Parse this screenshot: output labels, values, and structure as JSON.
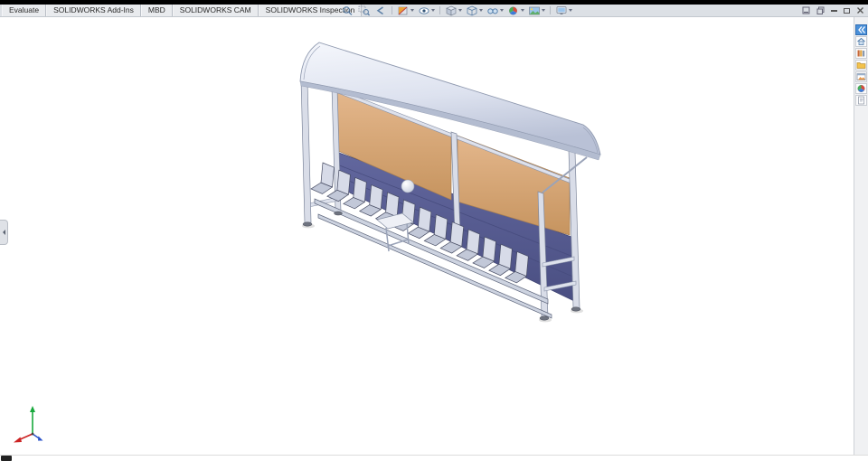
{
  "ribbon": {
    "tabs": [
      {
        "label": "Evaluate"
      },
      {
        "label": "SOLIDWORKS Add-Ins"
      },
      {
        "label": "MBD"
      },
      {
        "label": "SOLIDWORKS CAM"
      },
      {
        "label": "SOLIDWORKS Inspection"
      }
    ]
  },
  "hud_toolbar": {
    "tools": [
      {
        "name": "zoom-to-fit"
      },
      {
        "name": "zoom-to-area"
      },
      {
        "name": "previous-view"
      },
      {
        "name": "section-view",
        "dropdown": true
      },
      {
        "name": "dynamic-annotation-views",
        "dropdown": true
      },
      {
        "name": "view-orientation",
        "dropdown": true
      },
      {
        "name": "display-style",
        "dropdown": true
      },
      {
        "name": "hide-show-items",
        "dropdown": true
      },
      {
        "name": "edit-appearance",
        "dropdown": true
      },
      {
        "name": "apply-scene",
        "dropdown": true
      },
      {
        "name": "view-settings",
        "dropdown": true
      }
    ]
  },
  "window_controls": {
    "items": [
      {
        "name": "doc-minimize"
      },
      {
        "name": "doc-restore"
      },
      {
        "name": "minimize"
      },
      {
        "name": "maximize"
      },
      {
        "name": "close"
      }
    ]
  },
  "task_pane": {
    "items": [
      {
        "name": "expand-task-pane",
        "active": true
      },
      {
        "name": "solidworks-resources",
        "active": false
      },
      {
        "name": "design-library",
        "active": false
      },
      {
        "name": "file-explorer",
        "active": false
      },
      {
        "name": "view-palette",
        "active": false
      },
      {
        "name": "appearances-scenes",
        "active": false
      },
      {
        "name": "custom-properties",
        "active": false
      }
    ]
  },
  "viewport": {
    "model": {
      "description": "team-shelter-assembly",
      "seat_count": 13,
      "colors": {
        "frame": "#d9dde8",
        "roof": "#dde2ef",
        "back_panels": "#d9a97e",
        "lower_panel": "#565b90",
        "seats": "#d7dbe8"
      }
    },
    "triad_colors": {
      "x": "#cc2222",
      "y": "#18a83c",
      "z": "#2a52c9"
    }
  }
}
